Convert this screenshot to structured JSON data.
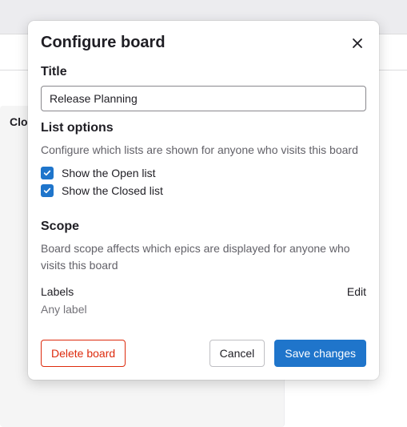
{
  "background": {
    "column_label": "Clo"
  },
  "modal": {
    "title": "Configure board",
    "sections": {
      "title": {
        "label": "Title",
        "value": "Release Planning"
      },
      "list_options": {
        "label": "List options",
        "hint": "Configure which lists are shown for anyone who visits this board",
        "checkboxes": [
          {
            "label": "Show the Open list",
            "checked": true
          },
          {
            "label": "Show the Closed list",
            "checked": true
          }
        ]
      },
      "scope": {
        "label": "Scope",
        "hint": "Board scope affects which epics are displayed for anyone who visits this board",
        "labels_row_title": "Labels",
        "edit_label": "Edit",
        "any_label_text": "Any label"
      }
    },
    "footer": {
      "delete": "Delete board",
      "cancel": "Cancel",
      "save": "Save changes"
    }
  }
}
